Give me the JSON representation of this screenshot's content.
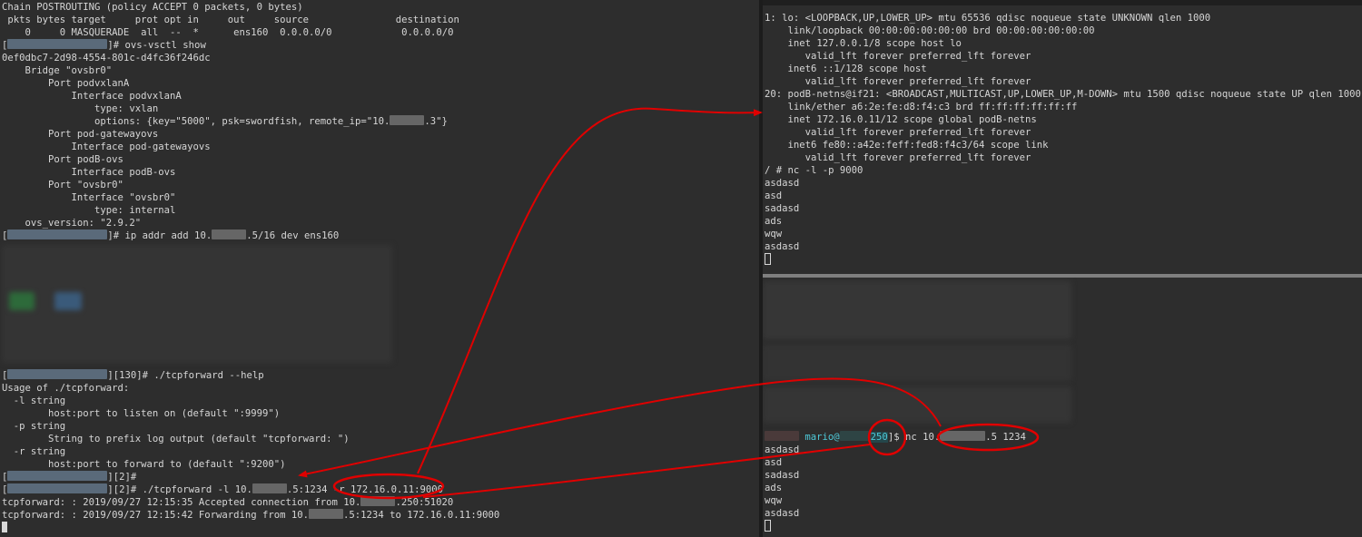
{
  "left_terminal": {
    "lines": [
      "Chain POSTROUTING (policy ACCEPT 0 packets, 0 bytes)",
      " pkts bytes target     prot opt in     out     source               destination",
      "    0     0 MASQUERADE  all  --  *      ens160  0.0.0.0/0            0.0.0.0/0",
      "]# ovs-vsctl show",
      "0ef0dbc7-2d98-4554-801c-d4fc36f246dc",
      "    Bridge \"ovsbr0\"",
      "        Port podvxlanA",
      "            Interface podvxlanA",
      "                type: vxlan",
      "                options: {key=\"5000\", psk=swordfish, remote_ip=\"10.",
      "        Port pod-gatewayovs",
      "            Interface pod-gatewayovs",
      "        Port podB-ovs",
      "            Interface podB-ovs",
      "        Port \"ovsbr0\"",
      "            Interface \"ovsbr0\"",
      "                type: internal",
      "    ovs_version: \"2.9.2\"",
      "]# ip addr add 10.",
      ".5/16 dev ens160",
      "][130]# ./tcpforward --help",
      "Usage of ./tcpforward:",
      "  -l string",
      "        host:port to listen on (default \":9999\")",
      "  -p string",
      "        String to prefix log output (default \"tcpforward: \")",
      "  -r string",
      "        host:port to forward to (default \":9200\")",
      "][2]#",
      "][2]# ./tcpforward -l 10.",
      ".5:1234 -r 172.16.0.11:9000",
      "tcpforward: : 2019/09/27 12:15:35 Accepted connection from 10.",
      ".250:51020",
      "tcpforward: : 2019/09/27 12:15:42 Forwarding from 10.",
      ".5:1234 to 172.16.0.11:9000",
      ".3\"}",
      "["
    ]
  },
  "right_top_terminal": {
    "lines": [
      "1: lo: <LOOPBACK,UP,LOWER_UP> mtu 65536 qdisc noqueue state UNKNOWN qlen 1000",
      "    link/loopback 00:00:00:00:00:00 brd 00:00:00:00:00:00",
      "    inet 127.0.0.1/8 scope host lo",
      "       valid_lft forever preferred_lft forever",
      "    inet6 ::1/128 scope host",
      "       valid_lft forever preferred_lft forever",
      "20: podB-netns@if21: <BROADCAST,MULTICAST,UP,LOWER_UP,M-DOWN> mtu 1500 qdisc noqueue state UP qlen 1000",
      "    link/ether a6:2e:fe:d8:f4:c3 brd ff:ff:ff:ff:ff:ff",
      "    inet 172.16.0.11/12 scope global podB-netns",
      "       valid_lft forever preferred_lft forever",
      "    inet6 fe80::a42e:feff:fed8:f4c3/64 scope link",
      "       valid_lft forever preferred_lft forever",
      "/ # nc -l -p 9000",
      "asdasd",
      "asd",
      "sadasd",
      "ads",
      "wqw",
      "asdasd"
    ]
  },
  "right_bottom_terminal": {
    "prompt_user": "mario@",
    "prompt_host_suffix": "250",
    "prompt_tail": "]$ nc 10.",
    "prompt_cmd_tail": ".5 1234",
    "lines": [
      "asdasd",
      "asd",
      "sadasd",
      "ads",
      "wqw",
      "asdasd"
    ]
  },
  "colors": {
    "annotation": "#e00000",
    "prompt_user": "#4ec9d8",
    "background": "#2d2d2d"
  }
}
